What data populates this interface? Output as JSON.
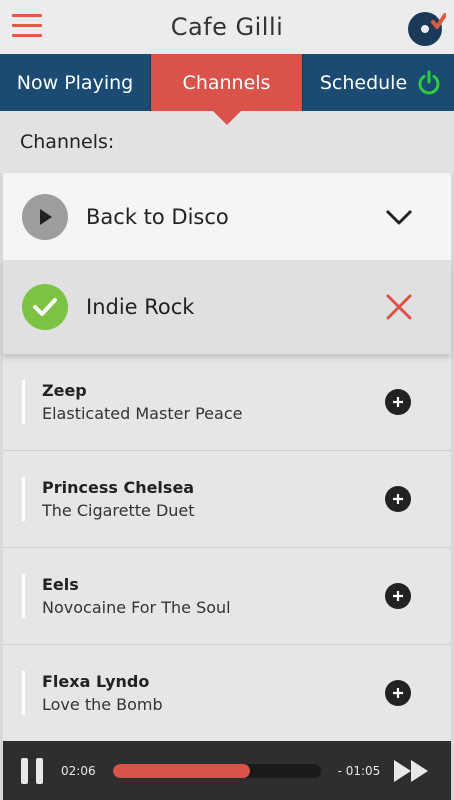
{
  "header": {
    "title": "Cafe Gilli",
    "menu_icon": "hamburger-icon",
    "logo_icon": "vinyl-heart-logo"
  },
  "tabs": [
    {
      "label": "Now Playing",
      "active": false
    },
    {
      "label": "Channels",
      "active": true
    },
    {
      "label": "Schedule",
      "active": false,
      "icon": "power-icon",
      "icon_color": "#2ecc40"
    }
  ],
  "section": {
    "title": "Channels:"
  },
  "channels": [
    {
      "name": "Back to Disco",
      "icon": "play-icon",
      "action_icon": "chevron-down-icon",
      "expanded": false
    },
    {
      "name": "Indie Rock",
      "icon": "check-icon",
      "action_icon": "close-icon",
      "expanded": true
    }
  ],
  "tracks": [
    {
      "artist": "Zeep",
      "title": "Elasticated Master Peace"
    },
    {
      "artist": "Princess Chelsea",
      "title": "The Cigarette Duet"
    },
    {
      "artist": "Eels",
      "title": "Novocaine For The Soul"
    },
    {
      "artist": "Flexa Lyndo",
      "title": "Love the Bomb"
    }
  ],
  "player": {
    "elapsed": "02:06",
    "remaining": "- 01:05",
    "progress_fraction": 0.66
  },
  "colors": {
    "accent": "#d9534a",
    "nav_blue": "#1b4a73",
    "success": "#7cc243",
    "player_bg": "#2e2e2e"
  }
}
